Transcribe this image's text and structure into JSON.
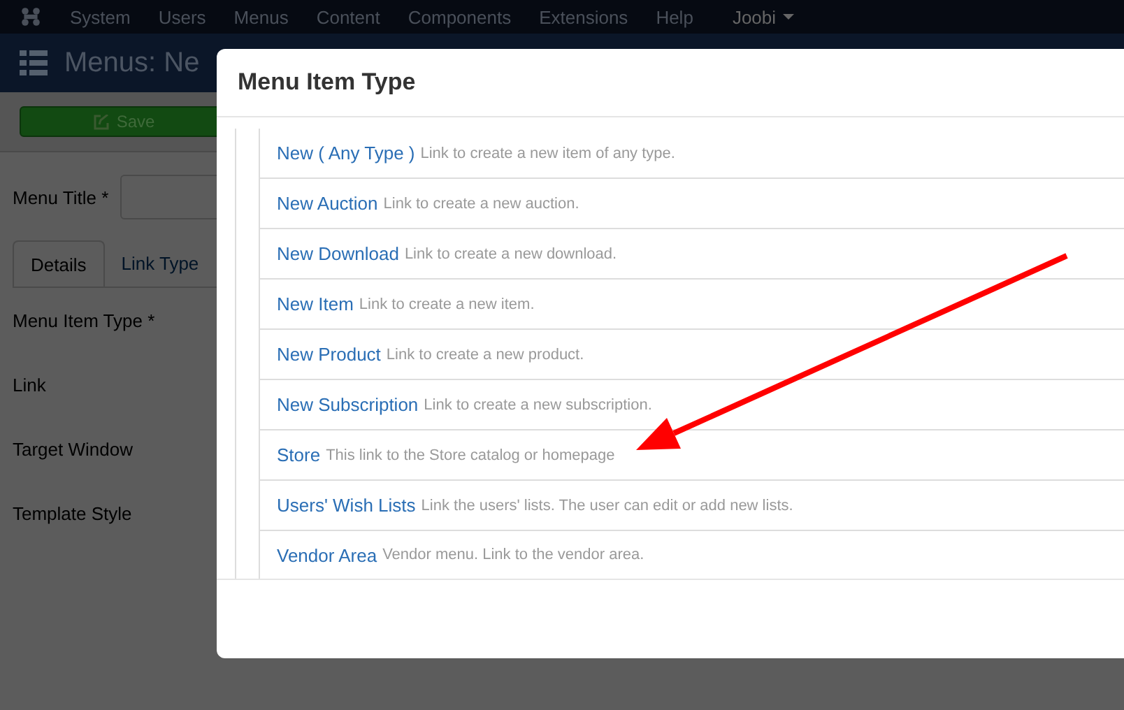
{
  "top_menu": {
    "items": [
      "System",
      "Users",
      "Menus",
      "Content",
      "Components",
      "Extensions",
      "Help"
    ],
    "user": "Joobi"
  },
  "page_header": {
    "title": "Menus: Ne"
  },
  "toolbar": {
    "save": "Save"
  },
  "form": {
    "menu_title_label": "Menu Title *",
    "tabs": [
      {
        "label": "Details",
        "selected": true
      },
      {
        "label": "Link Type",
        "selected": false
      }
    ],
    "fields": [
      "Menu Item Type *",
      "Link",
      "Target Window",
      "Template Style"
    ]
  },
  "modal": {
    "title": "Menu Item Type",
    "items": [
      {
        "name": "New ( Any Type )",
        "description": "Link to create a new item of any type."
      },
      {
        "name": "New Auction",
        "description": "Link to create a new auction."
      },
      {
        "name": "New Download",
        "description": "Link to create a new download."
      },
      {
        "name": "New Item",
        "description": "Link to create a new item."
      },
      {
        "name": "New Product",
        "description": "Link to create a new product."
      },
      {
        "name": "New Subscription",
        "description": "Link to create a new subscription."
      },
      {
        "name": "Store",
        "description": "This link to the Store catalog or homepage"
      },
      {
        "name": "Users' Wish Lists",
        "description": "Link the users' lists. The user can edit or add new lists."
      },
      {
        "name": "Vendor Area",
        "description": "Vendor menu. Link to the vendor area."
      }
    ]
  }
}
